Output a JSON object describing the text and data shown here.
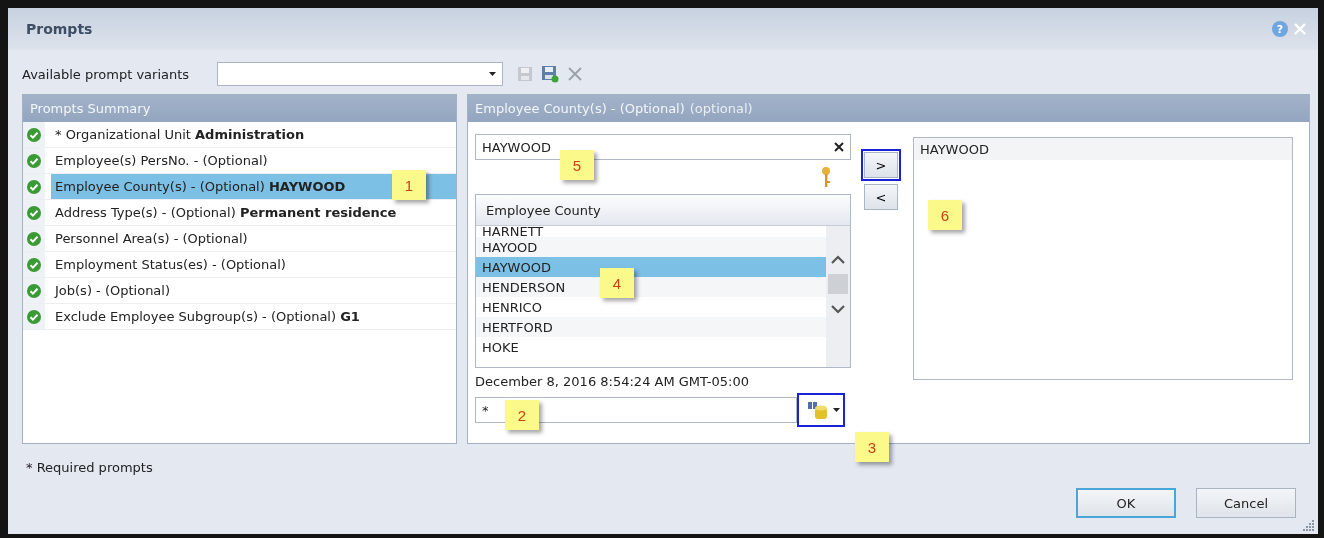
{
  "window": {
    "title": "Prompts",
    "help_label": "?"
  },
  "variants": {
    "label": "Available prompt variants"
  },
  "summary": {
    "title": "Prompts Summary",
    "items": [
      {
        "text": "* Organizational Unit **Administration**",
        "selected": false
      },
      {
        "text": "Employee(s) PersNo. -  (Optional)",
        "selected": false
      },
      {
        "text": "Employee County(s) - (Optional) **HAYWOOD**",
        "selected": true
      },
      {
        "text": "Address Type(s) - (Optional) **Permanent residence**",
        "selected": false
      },
      {
        "text": "Personnel Area(s) - (Optional)",
        "selected": false
      },
      {
        "text": "Employment Status(es) - (Optional)",
        "selected": false
      },
      {
        "text": "Job(s) - (Optional)",
        "selected": false
      },
      {
        "text": "Exclude Employee Subgroup(s) - (Optional) **G1**",
        "selected": false
      }
    ]
  },
  "prompt": {
    "title": "Employee County(s) - (Optional)",
    "subtitle": "(optional)",
    "search_value": "HAYWOOD",
    "list": {
      "column": "Employee County",
      "rows": [
        {
          "text": "HARNETT",
          "selected": false
        },
        {
          "text": "HAYOOD",
          "selected": false
        },
        {
          "text": "HAYWOOD",
          "selected": true
        },
        {
          "text": "HENDERSON",
          "selected": false
        },
        {
          "text": "HENRICO",
          "selected": false
        },
        {
          "text": "HERTFORD",
          "selected": false
        },
        {
          "text": "HOKE",
          "selected": false
        }
      ]
    },
    "refresh_date": "December 8, 2016 8:54:24 AM GMT-05:00",
    "pattern_value": "*",
    "search_button": {
      "highlighted": true
    },
    "add_button": {
      "label": ">",
      "highlighted": true
    },
    "remove_button": {
      "label": "<",
      "highlighted": false
    },
    "selected_values": [
      {
        "text": "HAYWOOD"
      }
    ]
  },
  "footnote": "* Required prompts",
  "buttons": [
    {
      "label": "OK",
      "kind": "default"
    },
    {
      "label": "Cancel",
      "kind": "normal"
    }
  ],
  "callouts": [
    {
      "label": "1"
    },
    {
      "label": "5"
    },
    {
      "label": "4"
    },
    {
      "label": "6"
    },
    {
      "label": "2"
    },
    {
      "label": "3"
    }
  ]
}
